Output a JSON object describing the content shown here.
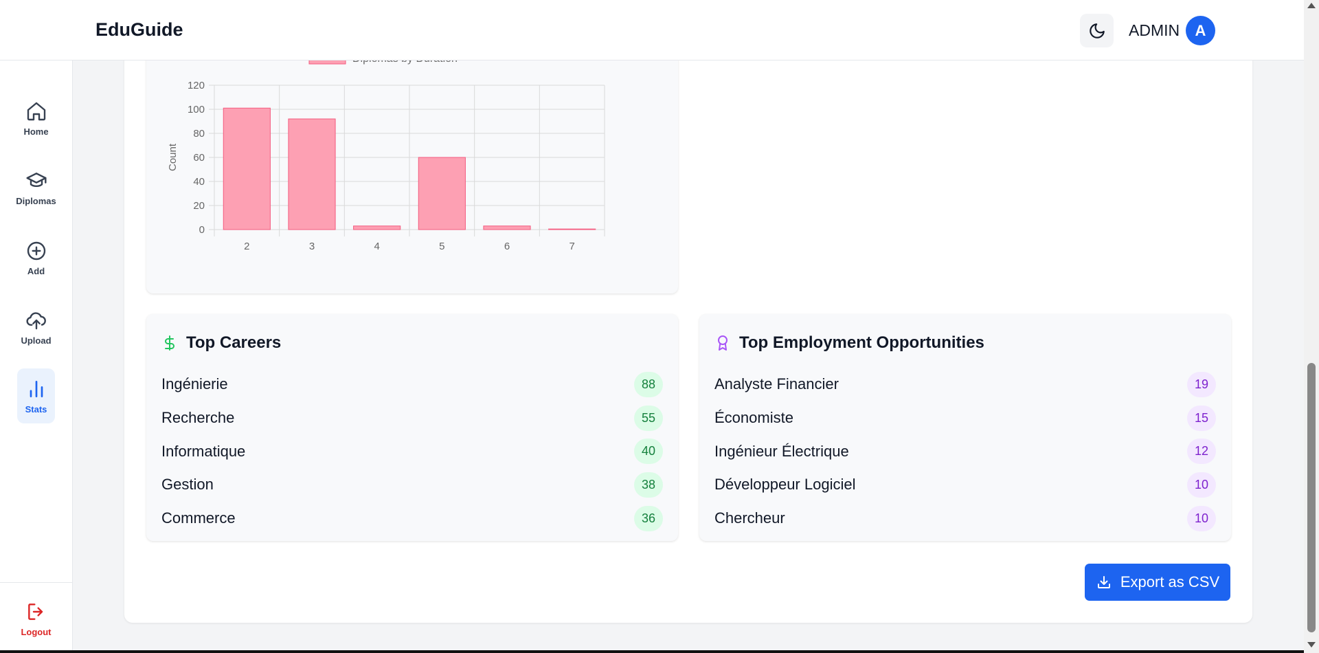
{
  "header": {
    "brand": "EduGuide",
    "user_label": "ADMIN",
    "avatar_initial": "A"
  },
  "sidebar": {
    "items": [
      {
        "label": "Home",
        "icon": "home-icon"
      },
      {
        "label": "Diplomas",
        "icon": "graduation-cap-icon"
      },
      {
        "label": "Add",
        "icon": "plus-circle-icon"
      },
      {
        "label": "Upload",
        "icon": "cloud-upload-icon"
      },
      {
        "label": "Stats",
        "icon": "bar-chart-icon",
        "active": true
      }
    ],
    "logout": {
      "label": "Logout",
      "icon": "logout-icon"
    }
  },
  "chart_data": {
    "type": "bar",
    "title": "",
    "categories": [
      "2",
      "3",
      "4",
      "5",
      "6",
      "7"
    ],
    "series": [
      {
        "name": "Diplomas by Duration",
        "values": [
          101,
          92,
          3,
          60,
          3,
          0.5
        ]
      }
    ],
    "xlabel": "",
    "ylabel": "Count",
    "ylim": [
      0,
      120
    ],
    "yticks": [
      0,
      20,
      40,
      60,
      80,
      100,
      120
    ],
    "grid": true,
    "legend": "top",
    "colors": {
      "fill": "#fda0b3",
      "stroke": "#f45b7f",
      "grid": "#d9d9d9"
    }
  },
  "top_careers": {
    "title": "Top Careers",
    "icon": "dollar-icon",
    "items": [
      {
        "label": "Ingénierie",
        "count": "88"
      },
      {
        "label": "Recherche",
        "count": "55"
      },
      {
        "label": "Informatique",
        "count": "40"
      },
      {
        "label": "Gestion",
        "count": "38"
      },
      {
        "label": "Commerce",
        "count": "36"
      }
    ]
  },
  "top_employment": {
    "title": "Top Employment Opportunities",
    "icon": "award-icon",
    "items": [
      {
        "label": "Analyste Financier",
        "count": "19"
      },
      {
        "label": "Économiste",
        "count": "15"
      },
      {
        "label": "Ingénieur Électrique",
        "count": "12"
      },
      {
        "label": "Développeur Logiciel",
        "count": "10"
      },
      {
        "label": "Chercheur",
        "count": "10"
      }
    ]
  },
  "export": {
    "label": "Export as CSV",
    "icon": "download-icon"
  },
  "colors": {
    "accent": "#1d64f0",
    "danger": "#dc2626",
    "green_badge": "#dcfce7",
    "purple_badge": "#f3e8ff"
  }
}
